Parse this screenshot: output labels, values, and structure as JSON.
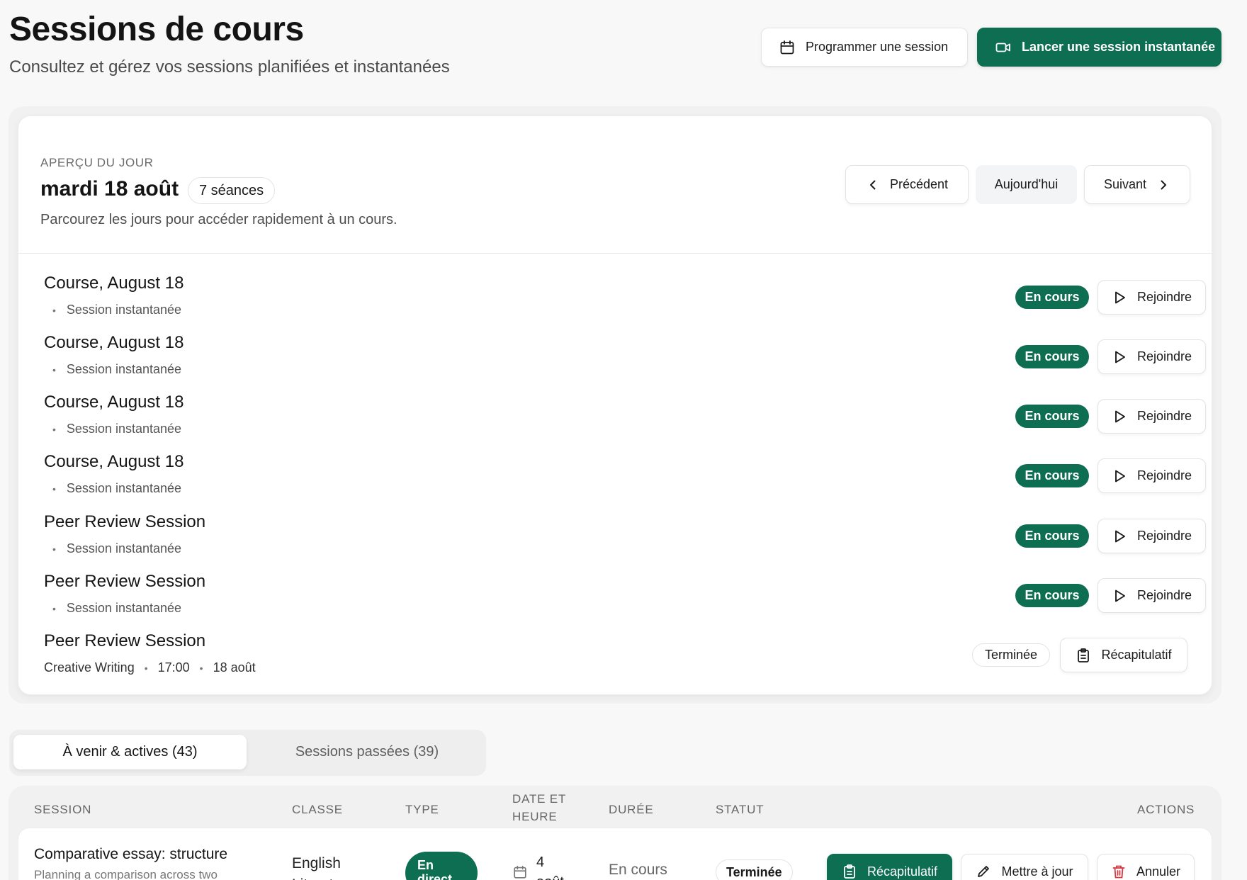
{
  "header": {
    "title": "Sessions de cours",
    "subtitle": "Consultez et gérez vos sessions planifiées et instantanées",
    "schedule_label": "Programmer une session",
    "instant_label": "Lancer une session instantanée"
  },
  "overview": {
    "eyebrow": "APERÇU DU JOUR",
    "date": "mardi 18 août",
    "count": "7 séances",
    "description": "Parcourez les jours pour accéder rapidement à un cours.",
    "prev_label": "Précédent",
    "today_label": "Aujourd'hui",
    "next_label": "Suivant",
    "sessions": [
      {
        "title": "Course, August 18",
        "type": "Session instantanée",
        "status": "En cours",
        "action": "Rejoindre"
      },
      {
        "title": "Course, August 18",
        "type": "Session instantanée",
        "status": "En cours",
        "action": "Rejoindre"
      },
      {
        "title": "Course, August 18",
        "type": "Session instantanée",
        "status": "En cours",
        "action": "Rejoindre"
      },
      {
        "title": "Course, August 18",
        "type": "Session instantanée",
        "status": "En cours",
        "action": "Rejoindre"
      },
      {
        "title": "Peer Review Session",
        "type": "Session instantanée",
        "status": "En cours",
        "action": "Rejoindre"
      },
      {
        "title": "Peer Review Session",
        "type": "Session instantanée",
        "status": "En cours",
        "action": "Rejoindre"
      },
      {
        "title": "Peer Review Session",
        "class": "Creative Writing",
        "time": "17:00",
        "date": "18 août",
        "status": "Terminée",
        "action": "Récapitulatif"
      }
    ]
  },
  "tabs": {
    "upcoming": "À venir & actives (43)",
    "past": "Sessions passées (39)"
  },
  "table": {
    "columns": {
      "session": "SESSION",
      "class": "CLASSE",
      "type": "TYPE",
      "datetime_1": "DATE ET",
      "datetime_2": "HEURE",
      "duration": "DURÉE",
      "status": "STATUT",
      "actions": "ACTIONS"
    },
    "rows": [
      {
        "title": "Comparative essay: structure",
        "description": "Planning a comparison across two",
        "class_1": "English",
        "class_2": "Literature",
        "type_1": "En",
        "type_2": "direct",
        "date_1": "4",
        "date_2": "août",
        "duration": "En cours",
        "status": "Terminée",
        "recap_label": "Récapitulatif",
        "update_label": "Mettre à jour",
        "cancel_label": "Annuler"
      }
    ]
  },
  "colors": {
    "primary": "#0d6e52",
    "cancel_icon": "#d9363e"
  }
}
